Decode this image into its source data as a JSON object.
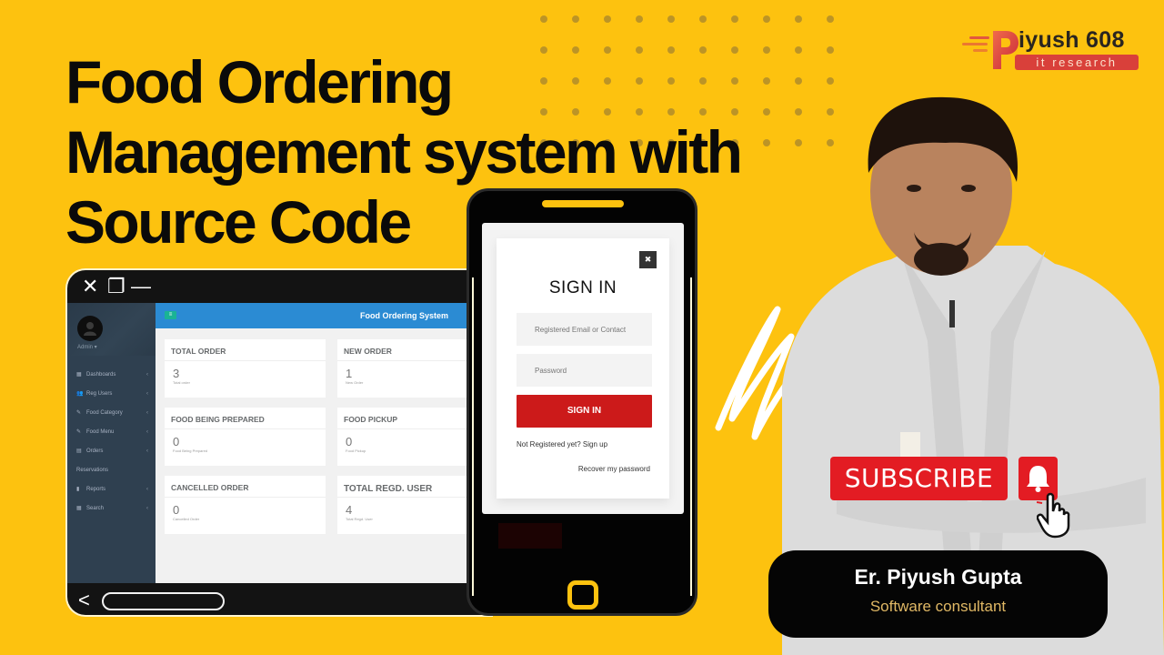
{
  "headline": {
    "line1": "Food Ordering",
    "line2": "Management system with",
    "line3": "Source Code"
  },
  "brand": {
    "name": "iyush 608",
    "tagline": "it research",
    "accent": "#d9403a"
  },
  "laptop": {
    "window_controls": {
      "close": "✕",
      "restore": "❐",
      "minimize": "—"
    },
    "app": {
      "title": "Food Ordering System",
      "menu_icon": "≡",
      "user": "Admin ▾",
      "nav": [
        {
          "icon": "▦",
          "label": "Dashboards",
          "chevron": "‹"
        },
        {
          "icon": "👥",
          "label": "Reg Users",
          "chevron": "‹"
        },
        {
          "icon": "✎",
          "label": "Food Category",
          "chevron": "‹"
        },
        {
          "icon": "✎",
          "label": "Food Menu",
          "chevron": "‹"
        },
        {
          "icon": "▤",
          "label": "Orders",
          "chevron": "‹"
        },
        {
          "icon": "",
          "label": "Reservations",
          "chevron": ""
        },
        {
          "icon": "▮",
          "label": "Reports",
          "chevron": "‹"
        },
        {
          "icon": "▦",
          "label": "Search",
          "chevron": "‹"
        }
      ],
      "cards": [
        {
          "title": "TOTAL ORDER",
          "value": "3",
          "sub": "Total order"
        },
        {
          "title": "NEW ORDER",
          "value": "1",
          "sub": "New Order"
        },
        {
          "title": "FOOD BEING PREPARED",
          "value": "0",
          "sub": "Food Being Prepared"
        },
        {
          "title": "FOOD PICKUP",
          "value": "0",
          "sub": "Food Pickup"
        },
        {
          "title": "CANCELLED ORDER",
          "value": "0",
          "sub": "Cancelled Order"
        },
        {
          "title": "TOTAL REGD. USER",
          "value": "4",
          "sub": "Total Regd. User"
        }
      ]
    },
    "back_icon": "<"
  },
  "phone": {
    "signin": {
      "close": "✖",
      "title": "SIGN IN",
      "email_placeholder": "Registered Email or Contact",
      "password_placeholder": "Password",
      "button": "SIGN IN",
      "signup_text": "Not Registered yet? Sign up",
      "recover_text": "Recover my password"
    },
    "button_color": "#cc1a1a"
  },
  "subscribe": {
    "label": "SUBSCRIBE",
    "color": "#e31c23"
  },
  "presenter": {
    "name": "Er. Piyush Gupta",
    "role": "Software consultant"
  },
  "colors": {
    "background": "#fdc20f",
    "sidebar": "#2f4050",
    "topbar": "#2b8bd3"
  }
}
